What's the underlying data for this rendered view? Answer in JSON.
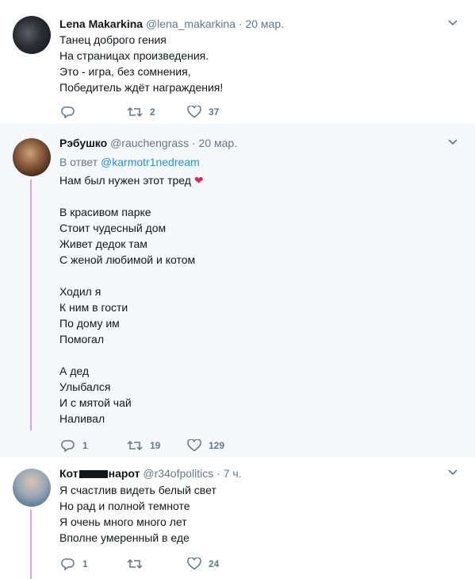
{
  "tweets": [
    {
      "name": "Lena Makarkina",
      "handle": "@lena_makarkina · 20 мар.",
      "lines": [
        "Танец доброго гения",
        "На страницах произведения.",
        "Это - игра, без сомнения,",
        "Победитель ждёт награждения!"
      ],
      "replies": "",
      "retweets": "2",
      "likes": "37"
    },
    {
      "name": "Рэбушко",
      "handle": "@rauchengrass · 20 мар.",
      "reply_prefix": "В ответ",
      "reply_handle": "@karmotr1nedream",
      "first_line": "Нам был нужен этот тред",
      "heart_emoji": "❤",
      "lines": [
        "",
        "В красивом парке",
        "Стоит чудесный дом",
        "Живет дедок там",
        "С женой любимой и котом",
        "",
        "Ходил я",
        "К ним в гости",
        "По дому им",
        "Помогал",
        "",
        "А дед",
        "Улыбался",
        "И с мятой чай",
        "Наливал"
      ],
      "replies": "1",
      "retweets": "19",
      "likes": "129"
    },
    {
      "name_start": "Кот",
      "name_end": "нарот",
      "handle": "@r34ofpolitics · 7 ч.",
      "lines": [
        "Я счастлив видеть белый свет",
        "Но рад и полной темноте",
        "Я очень много много лет",
        "Вполне умеренный в еде"
      ],
      "replies": "1",
      "retweets": "",
      "likes": "24"
    }
  ],
  "colors": {
    "thread_line": "#d6a2e8",
    "link": "#1b95e0",
    "muted": "#657786",
    "heart": "#e0245e"
  },
  "icons": [
    "reply-icon",
    "retweet-icon",
    "like-icon",
    "chevron-down-icon"
  ]
}
